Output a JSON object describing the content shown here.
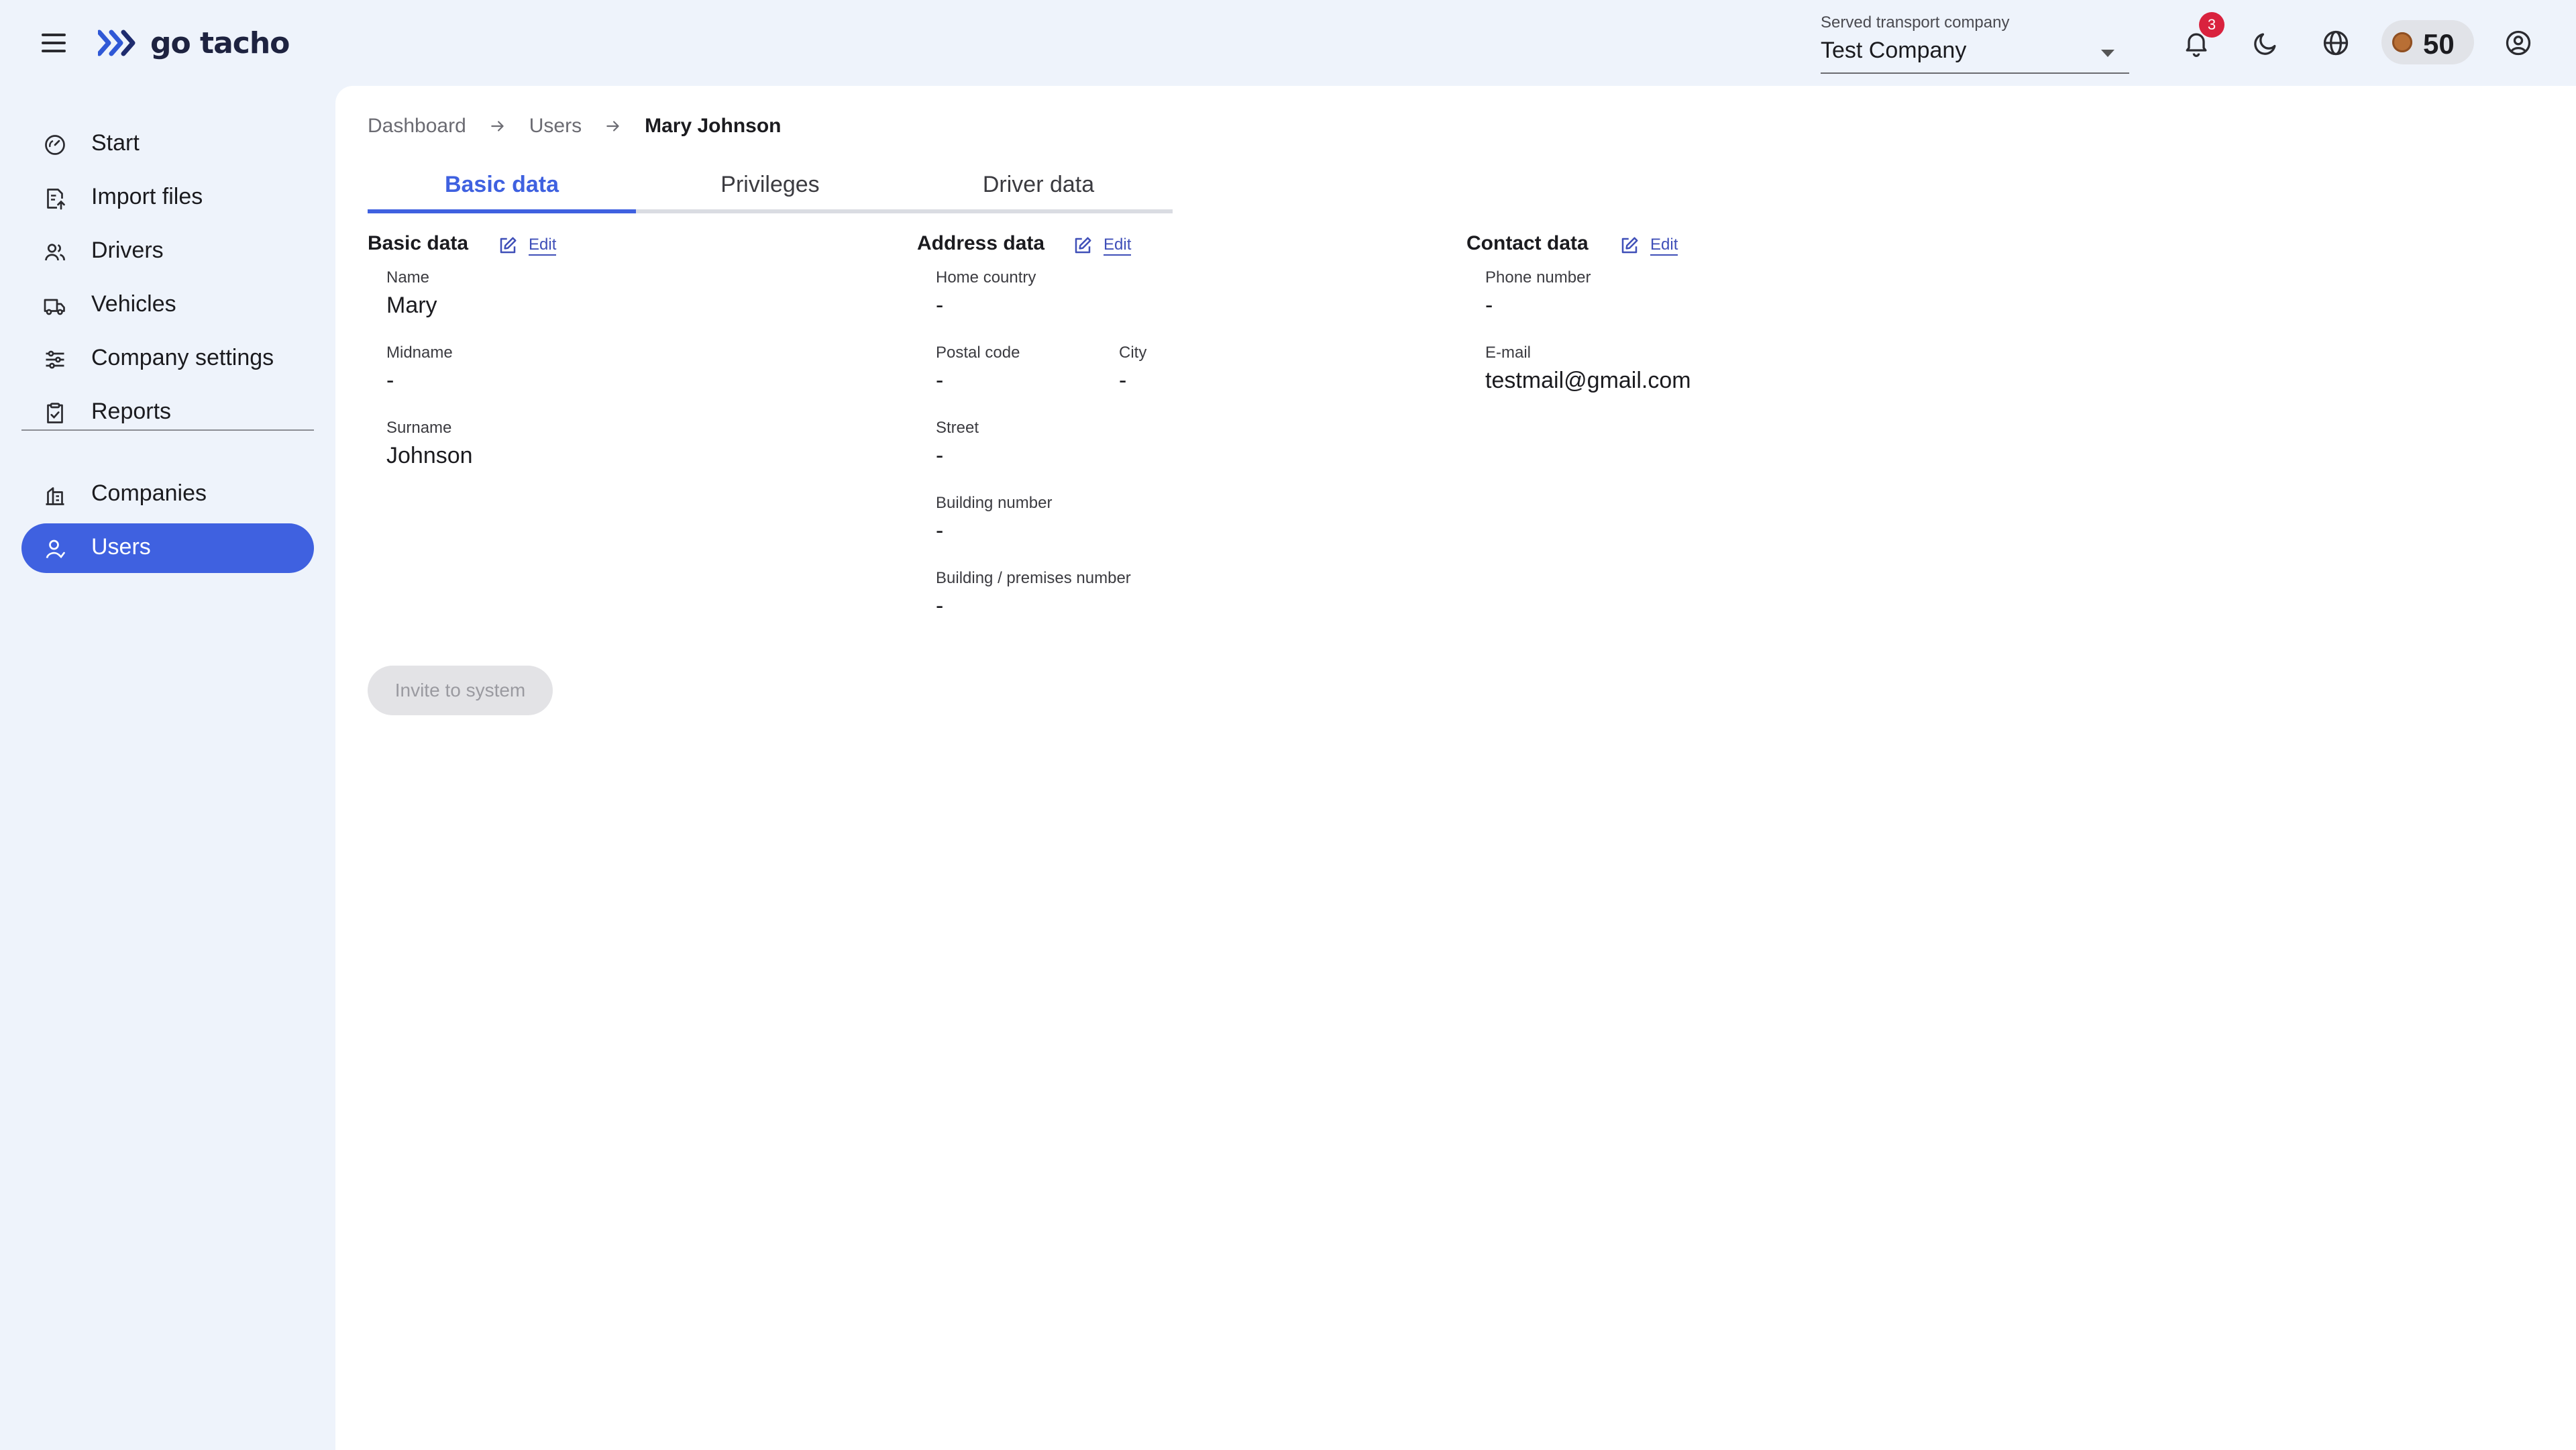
{
  "app": {
    "logo_text": "go tacho"
  },
  "header": {
    "company_select": {
      "label": "Served transport company",
      "value": "Test Company"
    },
    "notifications_count": "3",
    "credits": "50"
  },
  "sidebar": {
    "items": [
      {
        "label": "Start",
        "icon": "gauge-icon"
      },
      {
        "label": "Import files",
        "icon": "file-upload-icon"
      },
      {
        "label": "Drivers",
        "icon": "users-icon"
      },
      {
        "label": "Vehicles",
        "icon": "truck-icon"
      },
      {
        "label": "Company settings",
        "icon": "sliders-icon"
      },
      {
        "label": "Reports",
        "icon": "clipboard-icon"
      },
      {
        "label": "Companies",
        "icon": "building-icon"
      },
      {
        "label": "Users",
        "icon": "user-icon"
      }
    ],
    "active": "Users"
  },
  "breadcrumb": {
    "items": [
      "Dashboard",
      "Users"
    ],
    "current": "Mary Johnson"
  },
  "tabs": [
    {
      "label": "Basic data",
      "active": true
    },
    {
      "label": "Privileges",
      "active": false
    },
    {
      "label": "Driver data",
      "active": false
    }
  ],
  "basic_data": {
    "title": "Basic data",
    "edit_label": "Edit",
    "fields": [
      {
        "label": "Name",
        "value": "Mary"
      },
      {
        "label": "Midname",
        "value": "-"
      },
      {
        "label": "Surname",
        "value": "Johnson"
      }
    ]
  },
  "address_data": {
    "title": "Address data",
    "edit_label": "Edit",
    "fields": [
      {
        "label": "Home country",
        "value": "-"
      },
      {
        "label": "Postal code",
        "value": "-"
      },
      {
        "label": "City",
        "value": "-"
      },
      {
        "label": "Street",
        "value": "-"
      },
      {
        "label": "Building number",
        "value": "-"
      },
      {
        "label": "Building / premises number",
        "value": "-"
      }
    ]
  },
  "contact_data": {
    "title": "Contact data",
    "edit_label": "Edit",
    "fields": [
      {
        "label": "Phone number",
        "value": "-"
      },
      {
        "label": "E-mail",
        "value": "testmail@gmail.com"
      }
    ]
  },
  "actions": {
    "invite_label": "Invite to system"
  },
  "colors": {
    "accent": "#3f61e0",
    "background": "#eef3fb",
    "badge": "#d9223e"
  }
}
